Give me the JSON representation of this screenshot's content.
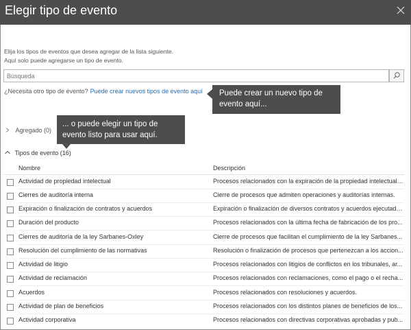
{
  "dialog": {
    "title": "Elegir tipo de evento",
    "close_icon": "close-icon"
  },
  "intro": {
    "line1": "Elija los tipos de eventos que desea agregar de la lista siguiente.",
    "line2": "Aquí solo puede agregarse un tipo de evento."
  },
  "search": {
    "placeholder": "Búsqueda",
    "value": "",
    "button_icon": "search-icon"
  },
  "need_other": {
    "text": "¿Necesita otro tipo de evento?",
    "link": "Puede crear nuevos tipos de evento aquí"
  },
  "callouts": {
    "create": "Puede crear un nuevo tipo de evento aquí...",
    "choose": "... o puede elegir un tipo de evento listo para usar aquí."
  },
  "groups": {
    "added": {
      "label": "Agregado (0)",
      "icon": "chevron-right-icon"
    },
    "types": {
      "label": "Tipos de evento (16)",
      "icon": "chevron-up-icon"
    }
  },
  "table": {
    "columns": {
      "name": "Nombre",
      "description": "Descripción"
    },
    "rows": [
      {
        "name": "Actividad de propiedad intelectual",
        "description": "Procesos relacionados con la expiración de la propiedad intelectual,..."
      },
      {
        "name": "Cierres de auditoría interna",
        "description": "Cierre de procesos que admiten operaciones y auditorías internas."
      },
      {
        "name": "Expiración o finalización de contratos y acuerdos",
        "description": "Expiración o finalización de diversos contratos y acuerdos ejecutados..."
      },
      {
        "name": "Duración del producto",
        "description": "Procesos relacionados con la última fecha de fabricación de los pro..."
      },
      {
        "name": "Cierres de auditoría de la ley Sarbanes-Oxley",
        "description": "Cierre de procesos que facilitan el cumplimiento de la ley Sarbanes..."
      },
      {
        "name": "Resolución del cumplimiento de las normativas",
        "description": "Resolución o finalización de procesos que pertenezcan a los accion..."
      },
      {
        "name": "Actividad de litigio",
        "description": "Procesos relacionados con litigios de conflictos en los tribunales, ar..."
      },
      {
        "name": "Actividad de reclamación",
        "description": "Procesos relacionados con reclamaciones, como el pago o el recha..."
      },
      {
        "name": "Acuerdos",
        "description": "Procesos relacionados con resoluciones y acuerdos."
      },
      {
        "name": "Actividad de plan de beneficios",
        "description": "Procesos relacionados con los distintos planes de beneficios de los..."
      },
      {
        "name": "Actividad corporativa",
        "description": "Procesos relacionados con directivas corporativas aprobadas y pub..."
      }
    ]
  }
}
